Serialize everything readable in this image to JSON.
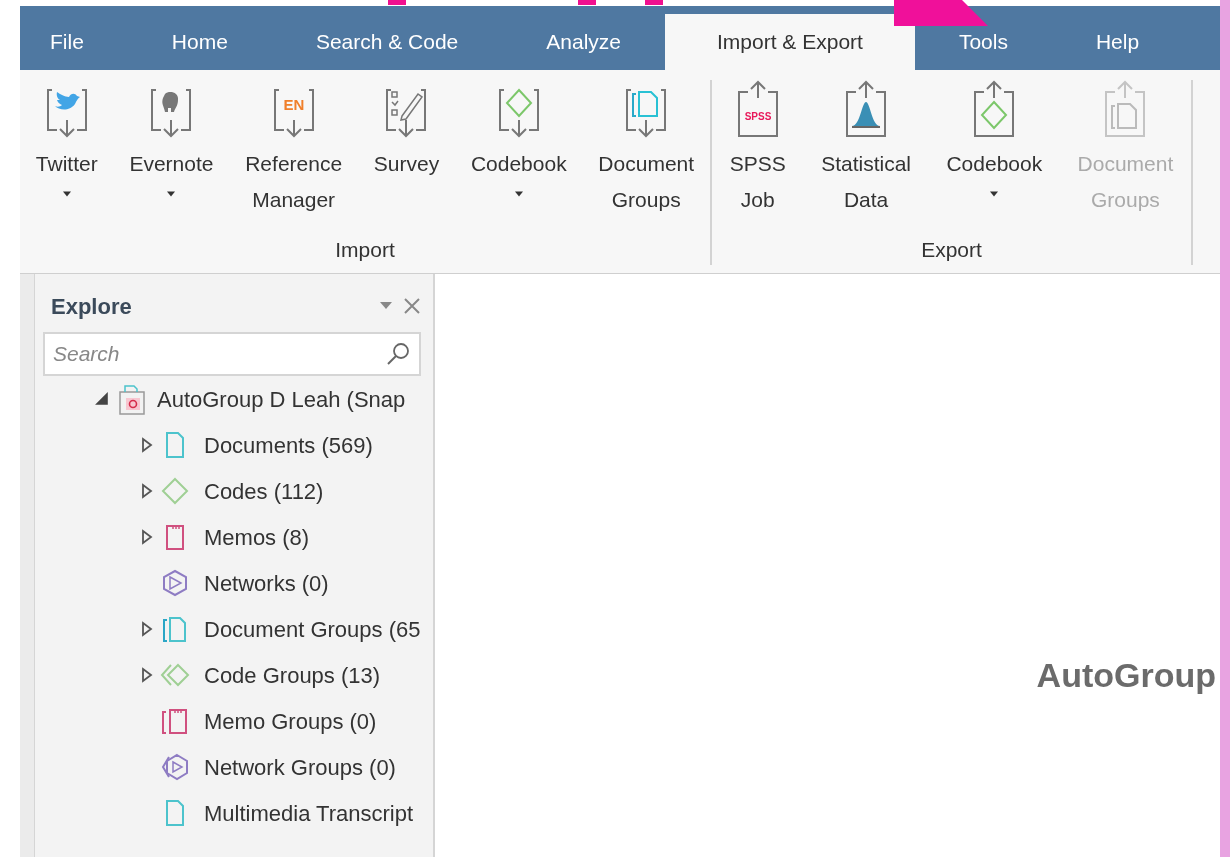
{
  "tabs": [
    {
      "label": "File",
      "selected": false
    },
    {
      "label": "Home",
      "selected": false
    },
    {
      "label": "Search & Code",
      "selected": false
    },
    {
      "label": "Analyze",
      "selected": false
    },
    {
      "label": "Import & Export",
      "selected": true
    },
    {
      "label": "Tools",
      "selected": false
    },
    {
      "label": "Help",
      "selected": false
    }
  ],
  "ribbon_groups": [
    {
      "label": "Import",
      "buttons": [
        {
          "label_lines": [
            "Twitter"
          ],
          "dropdown": true,
          "disabled": false
        },
        {
          "label_lines": [
            "Evernote"
          ],
          "dropdown": true,
          "disabled": false
        },
        {
          "label_lines": [
            "Reference",
            "Manager"
          ],
          "dropdown": false,
          "disabled": false,
          "icon_text": "EN"
        },
        {
          "label_lines": [
            "Survey"
          ],
          "dropdown": false,
          "disabled": false
        },
        {
          "label_lines": [
            "Codebook"
          ],
          "dropdown": true,
          "disabled": false
        },
        {
          "label_lines": [
            "Document",
            "Groups"
          ],
          "dropdown": false,
          "disabled": false
        }
      ]
    },
    {
      "label": "Export",
      "buttons": [
        {
          "label_lines": [
            "SPSS",
            "Job"
          ],
          "dropdown": false,
          "disabled": false,
          "icon_text": "SPSS"
        },
        {
          "label_lines": [
            "Statistical",
            "Data"
          ],
          "dropdown": false,
          "disabled": false
        },
        {
          "label_lines": [
            "Codebook"
          ],
          "dropdown": true,
          "disabled": false
        },
        {
          "label_lines": [
            "Document",
            "Groups"
          ],
          "dropdown": false,
          "disabled": true
        }
      ]
    }
  ],
  "explore_panel": {
    "title": "Explore",
    "search": {
      "placeholder": "Search"
    },
    "tree": {
      "label": "AutoGroup D Leah (Snap",
      "expandable": true,
      "expanded": true,
      "children": [
        {
          "label": "Documents (569)",
          "expandable": true,
          "expanded": false
        },
        {
          "label": "Codes (112)",
          "expandable": true,
          "expanded": false
        },
        {
          "label": "Memos (8)",
          "expandable": true,
          "expanded": false
        },
        {
          "label": "Networks (0)",
          "expandable": false
        },
        {
          "label": "Document Groups (65",
          "expandable": true,
          "expanded": false
        },
        {
          "label": "Code Groups (13)",
          "expandable": true,
          "expanded": false
        },
        {
          "label": "Memo Groups (0)",
          "expandable": false
        },
        {
          "label": "Network Groups (0)",
          "expandable": false
        },
        {
          "label": "Multimedia Transcript",
          "expandable": false
        }
      ]
    }
  },
  "document_title": "AutoGroup"
}
